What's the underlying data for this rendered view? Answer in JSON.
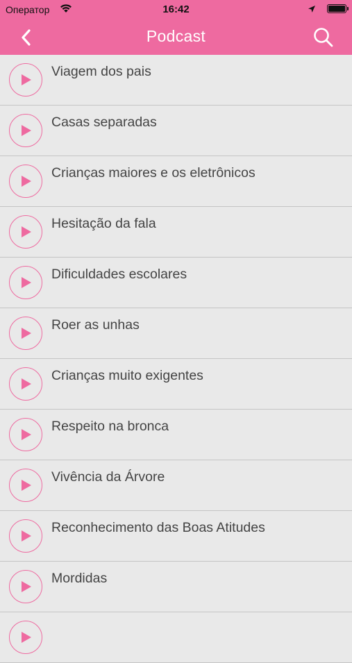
{
  "status_bar": {
    "carrier": "Оператор",
    "time": "16:42"
  },
  "nav": {
    "title": "Podcast"
  },
  "colors": {
    "accent": "#ee6aa0",
    "background": "#e9e9e9",
    "divider": "#c4c4c4"
  },
  "podcasts": [
    "Viagem dos pais",
    "Casas separadas",
    "Crianças maiores e os eletrônicos",
    "Hesitação da fala",
    "Dificuldades escolares",
    "Roer as unhas",
    "Crianças muito exigentes",
    "Respeito na bronca",
    "Vivência da Árvore",
    "Reconhecimento das Boas Atitudes",
    "Mordidas",
    ""
  ]
}
